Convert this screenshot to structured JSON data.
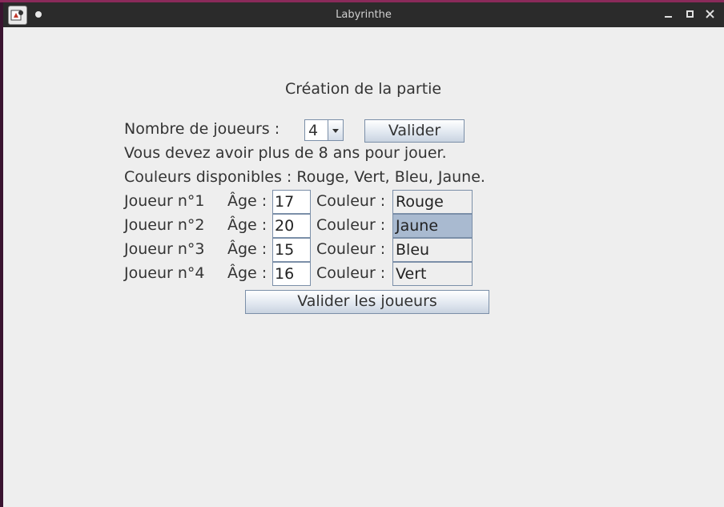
{
  "window": {
    "title": "Labyrinthe"
  },
  "form": {
    "heading": "Création de la partie",
    "nb_players_label": "Nombre de joueurs :",
    "nb_players_value": "4",
    "validate_label": "Valider",
    "age_notice": "Vous devez avoir plus de 8 ans pour jouer.",
    "colors_available": "Couleurs disponibles : Rouge, Vert, Bleu, Jaune.",
    "age_label": "Âge :",
    "color_label": "Couleur :",
    "players": [
      {
        "label": "Joueur n°1",
        "age": "17",
        "color": "Rouge"
      },
      {
        "label": "Joueur n°2",
        "age": "20",
        "color": "Jaune"
      },
      {
        "label": "Joueur n°3",
        "age": "15",
        "color": "Bleu"
      },
      {
        "label": "Joueur n°4",
        "age": "16",
        "color": "Vert"
      }
    ],
    "validate_players_label": "Valider les joueurs"
  },
  "colors": {
    "titlebar": "#2b2b2b",
    "background": "#eeeeee",
    "selected": "#a9bad0"
  }
}
